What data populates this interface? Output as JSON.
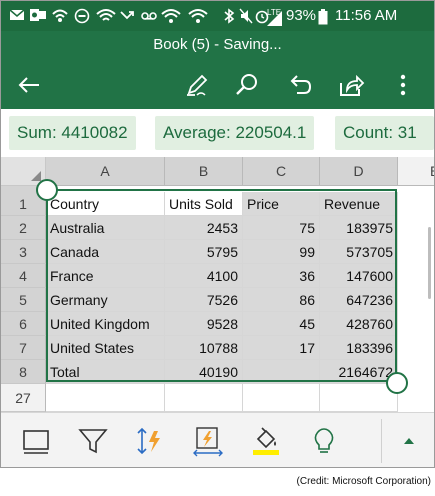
{
  "status_bar": {
    "icons": [
      "mail-icon",
      "outlook-icon",
      "wifi-calling-icon",
      "do-not-disturb-icon",
      "wifi-icon",
      "missed-call-icon",
      "voicemail-icon",
      "wifi-icon",
      "bluetooth-icon",
      "mute-icon",
      "alarm-icon",
      "lte-signal-icon",
      "battery-icon"
    ],
    "battery_percent": "93%",
    "time": "11:56 AM",
    "lte_label": "LTE"
  },
  "title_bar": {
    "title": "Book (5) - Saving..."
  },
  "toolbar": {
    "buttons": [
      "back-arrow-icon",
      "edit-pen-icon",
      "search-icon",
      "undo-icon",
      "share-icon",
      "more-vertical-icon"
    ]
  },
  "stats": {
    "sum": "Sum: 4410082",
    "average": "Average: 220504.1",
    "count": "Count: 31"
  },
  "grid": {
    "columns": [
      "A",
      "B",
      "C",
      "D",
      "E"
    ],
    "row_numbers": [
      "1",
      "2",
      "3",
      "4",
      "5",
      "6",
      "7",
      "8",
      "27"
    ],
    "rows": [
      [
        "Country",
        "Units Sold",
        "Price",
        "Revenue"
      ],
      [
        "Australia",
        "2453",
        "75",
        "183975"
      ],
      [
        "Canada",
        "5795",
        "99",
        "573705"
      ],
      [
        "France",
        "4100",
        "36",
        "147600"
      ],
      [
        "Germany",
        "7526",
        "86",
        "647236"
      ],
      [
        "United Kingdom",
        "9528",
        "45",
        "428760"
      ],
      [
        "United States",
        "10788",
        "17",
        "183396"
      ],
      [
        "Total",
        "40190",
        "",
        "2164672"
      ]
    ]
  },
  "bottom_bar": {
    "buttons": [
      "comment-icon",
      "filter-icon",
      "sort-icon",
      "flash-fill-icon",
      "fill-color-icon",
      "idea-lightbulb-icon",
      "expand-up-icon"
    ],
    "fill_accent_color": "#ffee00"
  },
  "colors": {
    "brand_green": "#217346",
    "status_green": "#1d6b3e",
    "stat_pill_bg": "#e1efe1"
  },
  "credit": "(Credit: Microsoft Corporation)"
}
